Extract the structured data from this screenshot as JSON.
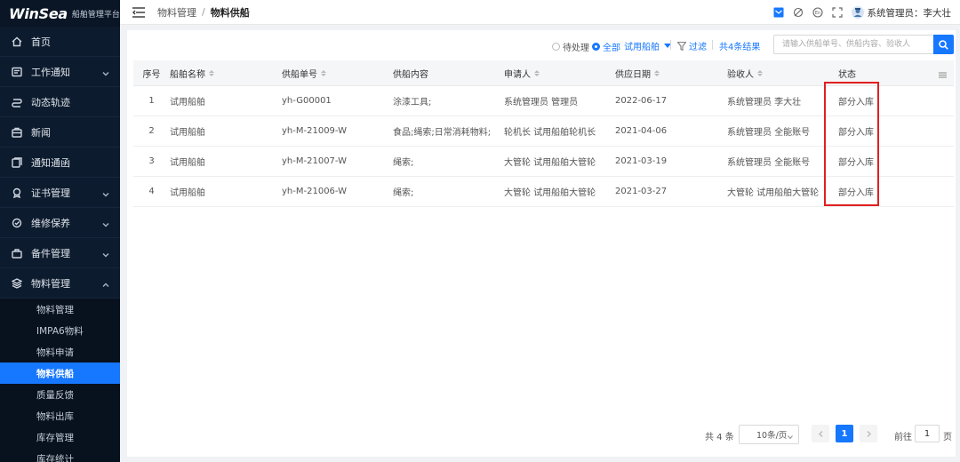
{
  "brand": {
    "logo": "WinSea",
    "subtitle": "船舶管理平台"
  },
  "sidebar": {
    "items": [
      {
        "label": "首页",
        "icon": "home-icon",
        "expandable": false
      },
      {
        "label": "工作通知",
        "icon": "notice-icon",
        "expandable": true
      },
      {
        "label": "动态轨迹",
        "icon": "track-icon",
        "expandable": false
      },
      {
        "label": "新闻",
        "icon": "news-icon",
        "expandable": false
      },
      {
        "label": "通知通函",
        "icon": "circular-icon",
        "expandable": false
      },
      {
        "label": "证书管理",
        "icon": "certificate-icon",
        "expandable": true
      },
      {
        "label": "维修保养",
        "icon": "maintenance-icon",
        "expandable": true
      },
      {
        "label": "备件管理",
        "icon": "spare-parts-icon",
        "expandable": true
      },
      {
        "label": "物料管理",
        "icon": "materials-icon",
        "expandable": true,
        "expanded": true
      }
    ],
    "submenu": [
      {
        "label": "物料管理",
        "active": false
      },
      {
        "label": "IMPA6物料",
        "active": false
      },
      {
        "label": "物料申请",
        "active": false
      },
      {
        "label": "物料供船",
        "active": true
      },
      {
        "label": "质量反馈",
        "active": false
      },
      {
        "label": "物料出库",
        "active": false
      },
      {
        "label": "库存管理",
        "active": false
      },
      {
        "label": "库存统计",
        "active": false
      }
    ]
  },
  "header": {
    "breadcrumb": [
      "物料管理",
      "物料供船"
    ],
    "user_label": "系统管理员：李大壮"
  },
  "toolbar": {
    "radio_pending": "待处理",
    "radio_all": "全部",
    "ship_select": "试用船舶",
    "filter_label": "过滤",
    "total_results": "共4条结果",
    "search_placeholder": "请输入供船单号、供船内容、验收人"
  },
  "table": {
    "columns": [
      "序号",
      "船舶名称",
      "供船单号",
      "供船内容",
      "申请人",
      "供应日期",
      "验收人",
      "状态"
    ],
    "sortable": [
      false,
      true,
      true,
      false,
      true,
      true,
      true,
      false
    ],
    "rows": [
      {
        "no": "1",
        "ship": "试用船舶",
        "order": "yh-G00001",
        "content": "涂漆工具;",
        "applicant": "系统管理员 管理员",
        "date": "2022-06-17",
        "receiver": "系统管理员 李大壮",
        "status": "部分入库"
      },
      {
        "no": "2",
        "ship": "试用船舶",
        "order": "yh-M-21009-W",
        "content": "食品;绳索;日常消耗物料;",
        "applicant": "轮机长 试用船舶轮机长",
        "date": "2021-04-06",
        "receiver": "系统管理员 全能账号",
        "status": "部分入库"
      },
      {
        "no": "3",
        "ship": "试用船舶",
        "order": "yh-M-21007-W",
        "content": "绳索;",
        "applicant": "大管轮 试用船舶大管轮",
        "date": "2021-03-19",
        "receiver": "系统管理员 全能账号",
        "status": "部分入库"
      },
      {
        "no": "4",
        "ship": "试用船舶",
        "order": "yh-M-21006-W",
        "content": "绳索;",
        "applicant": "大管轮 试用船舶大管轮",
        "date": "2021-03-27",
        "receiver": "大管轮 试用船舶大管轮",
        "status": "部分入库"
      }
    ]
  },
  "pagination": {
    "total": "共 4 条",
    "page_size": "10条/页",
    "current_page": "1",
    "goto_label": "前往",
    "goto_value": "1",
    "page_suffix": "页"
  },
  "colors": {
    "accent": "#1677ff",
    "sidebar_bg": "#0d1b2e",
    "highlight": "#e02020"
  }
}
